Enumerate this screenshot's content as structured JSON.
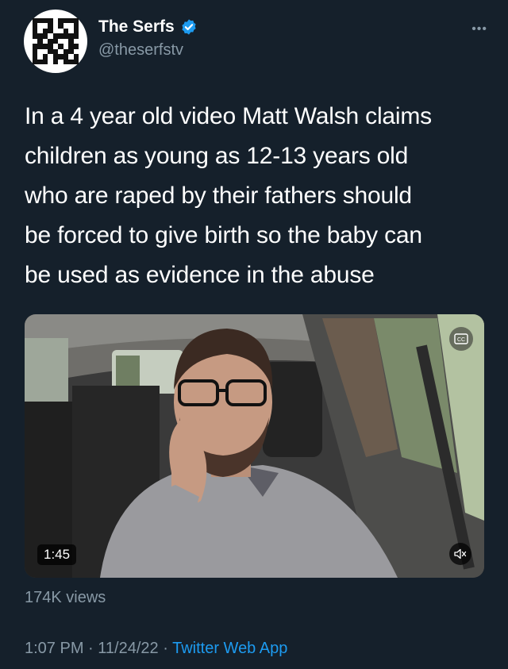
{
  "author": {
    "display_name": "The Serfs",
    "handle": "@theserfstv",
    "verified": true,
    "avatar_icon": "qr-code-avatar",
    "verified_icon": "verified-badge-icon",
    "verified_color": "#1d9bf0"
  },
  "more_icon": "more-options-icon",
  "tweet": {
    "lines": [
      "In a 4 year old video Matt Walsh claims",
      "children as young as 12-13 years old",
      "who are raped by their fathers should",
      "be forced to give birth so the baby can",
      "be used as evidence in the abuse"
    ]
  },
  "media": {
    "duration": "1:45",
    "mute_icon": "volume-muted-icon",
    "captions_icon": "captions-icon",
    "views": "174K views"
  },
  "footer": {
    "time": "1:07 PM",
    "separator": "·",
    "date": "11/24/22",
    "source": "Twitter Web App"
  },
  "colors": {
    "background": "#15202b",
    "secondary_text": "#8899a6",
    "link": "#1d9bf0"
  }
}
